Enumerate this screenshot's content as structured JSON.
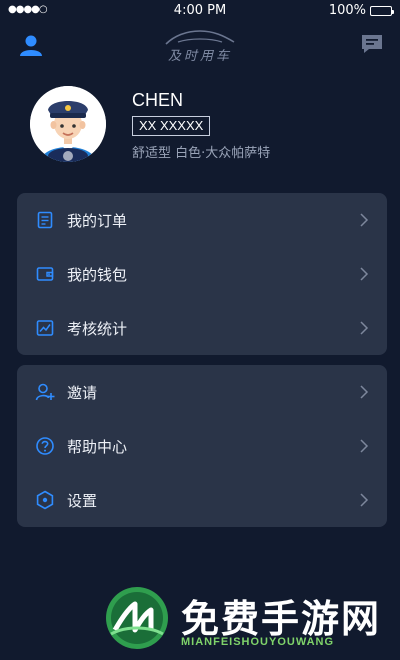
{
  "status_bar": {
    "signal": "●●●●○",
    "time": "4:00 PM",
    "battery": "100%",
    "battery_level": 1.0
  },
  "header": {
    "brand": "及时用车"
  },
  "profile": {
    "name": "CHEN",
    "plate": "XX XXXXX",
    "car": "舒适型 白色·大众帕萨特"
  },
  "menu_group_1": {
    "items": [
      {
        "label": "我的订单",
        "icon": "order-icon"
      },
      {
        "label": "我的钱包",
        "icon": "wallet-icon"
      },
      {
        "label": "考核统计",
        "icon": "stats-icon"
      }
    ]
  },
  "menu_group_2": {
    "items": [
      {
        "label": "邀请",
        "icon": "invite-icon"
      },
      {
        "label": "帮助中心",
        "icon": "help-icon"
      },
      {
        "label": "设置",
        "icon": "settings-icon"
      }
    ]
  },
  "watermark": {
    "title": "免费手游网",
    "subtitle": "MIANFEISHOUYOUWANG"
  },
  "colors": {
    "background": "#111a2e",
    "card": "#2a3448",
    "accent": "#2f8cff"
  }
}
